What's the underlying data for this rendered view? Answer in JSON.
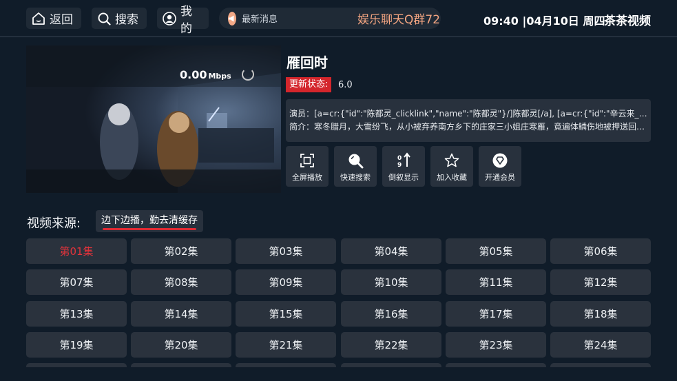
{
  "header": {
    "back_label": "返回",
    "search_label": "搜索",
    "mine_label": "我的",
    "news_label": "最新消息",
    "news_text": "娱乐聊天Q群72",
    "clock": "09:40 |04月10日 周四",
    "app_name": "茶茶视频"
  },
  "player": {
    "speed_value": "0.00",
    "speed_unit": "Mbps"
  },
  "info": {
    "title": "雁回时",
    "update_badge": "更新状态:",
    "update_value": "6.0",
    "cast": "演员：[a=cr:{\"id\":\"陈都灵_clicklink\",\"name\":\"陈都灵\"}/]陈都灵[/a], [a=cr:{\"id\":\"辛云来_clicklink\",\"name\":\"辛云来\"}/]辛云来[/a]",
    "synopsis": "简介：寒冬腊月，大雪纷飞，从小被弃养南方乡下的庄家三小姐庄寒雁，竟遍体鳞伤地被押送回京城"
  },
  "actions": [
    {
      "label": "全屏播放",
      "icon": "fullscreen-icon"
    },
    {
      "label": "快速搜索",
      "icon": "search-icon"
    },
    {
      "label": "倒叙显示",
      "icon": "sort-icon"
    },
    {
      "label": "加入收藏",
      "icon": "star-icon"
    },
    {
      "label": "开通会员",
      "icon": "vip-icon"
    }
  ],
  "source": {
    "label": "视频来源:",
    "current": "边下边播，勤去清缓存"
  },
  "episodes": [
    "第01集",
    "第02集",
    "第03集",
    "第04集",
    "第05集",
    "第06集",
    "第07集",
    "第08集",
    "第09集",
    "第10集",
    "第11集",
    "第12集",
    "第13集",
    "第14集",
    "第15集",
    "第16集",
    "第17集",
    "第18集",
    "第19集",
    "第20集",
    "第21集",
    "第22集",
    "第23集",
    "第24集"
  ],
  "active_episode": "第01集",
  "colors": {
    "background": "#101c29",
    "accent_red": "#d4262c",
    "news_text": "#f5a682"
  }
}
